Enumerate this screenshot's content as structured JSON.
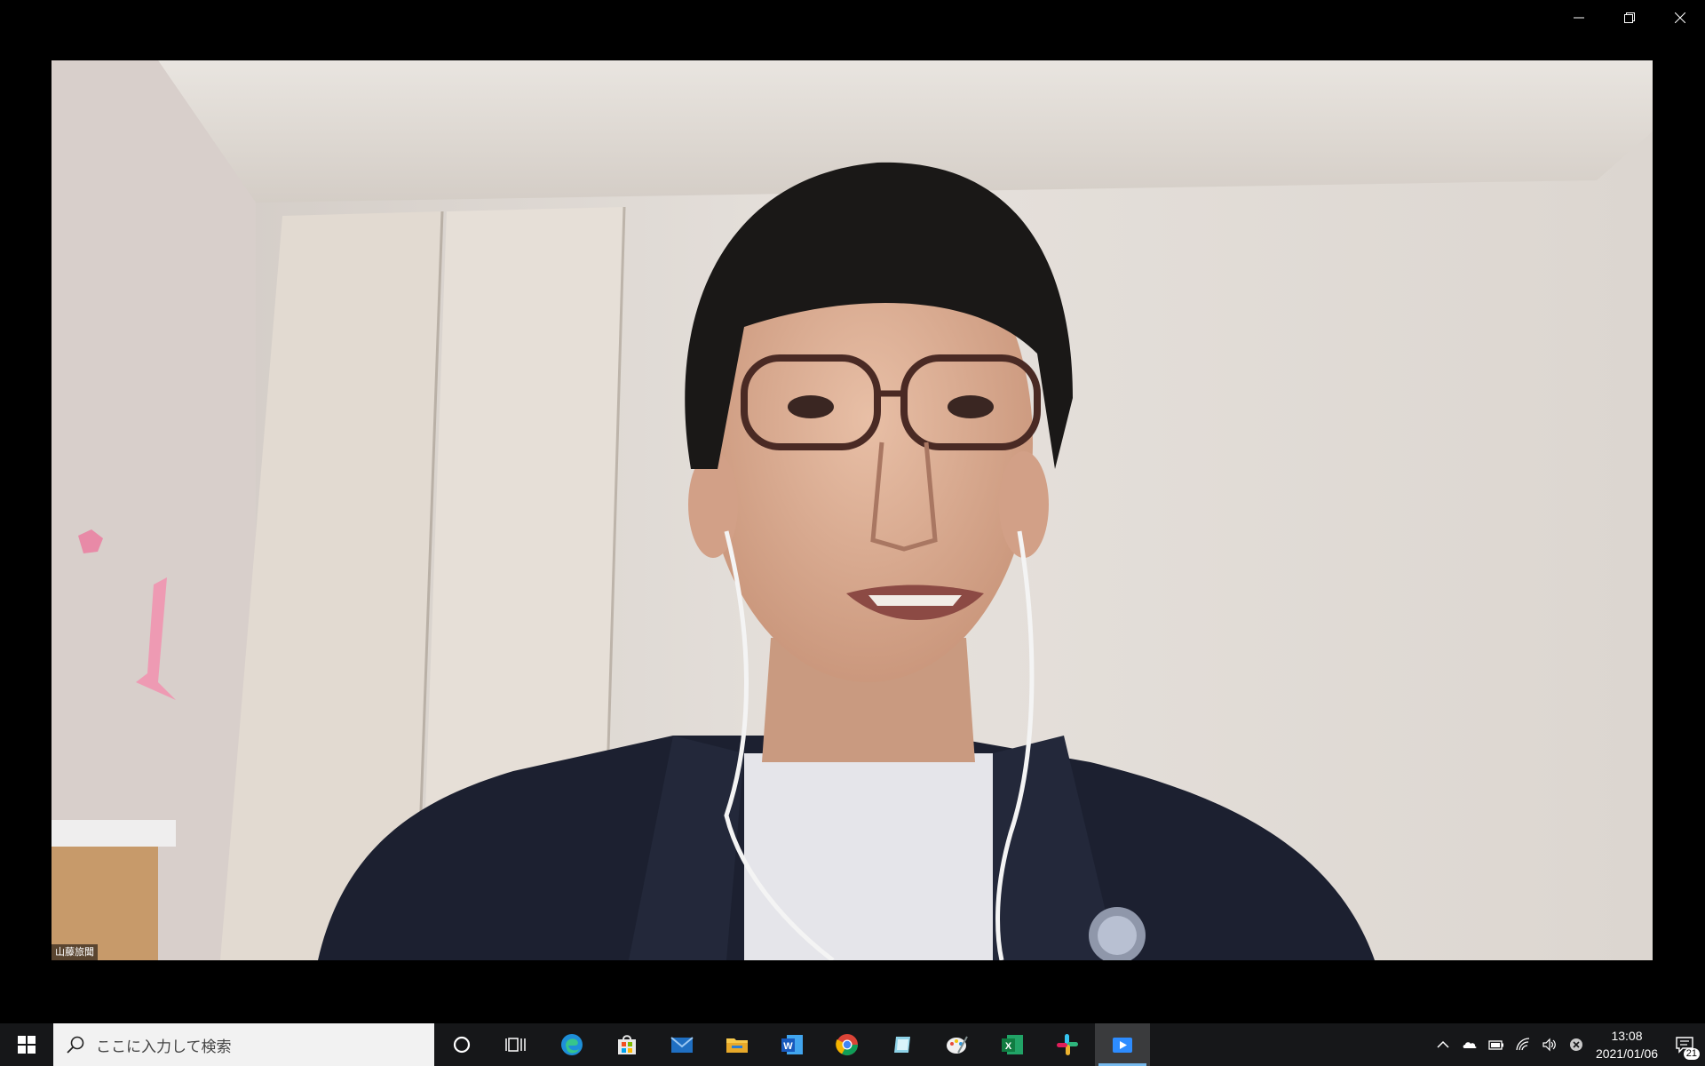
{
  "window": {
    "controls": [
      {
        "name": "minimize-button",
        "icon": "minimize-icon"
      },
      {
        "name": "restore-button",
        "icon": "restore-icon"
      },
      {
        "name": "close-button",
        "icon": "close-icon"
      }
    ]
  },
  "video": {
    "participant_name": "山藤旅聞"
  },
  "taskbar": {
    "search_placeholder": "ここに入力して検索",
    "apps": [
      {
        "name": "cortana-button",
        "icon": "circle-icon"
      },
      {
        "name": "task-view-button",
        "icon": "task-view-icon"
      },
      {
        "name": "edge-button",
        "icon": "edge-icon"
      },
      {
        "name": "store-button",
        "icon": "store-icon"
      },
      {
        "name": "mail-button",
        "icon": "mail-icon"
      },
      {
        "name": "file-explorer-button",
        "icon": "folder-icon"
      },
      {
        "name": "word-button",
        "icon": "word-icon"
      },
      {
        "name": "chrome-button",
        "icon": "chrome-icon"
      },
      {
        "name": "notes-button",
        "icon": "notes-icon"
      },
      {
        "name": "paint-button",
        "icon": "paint-icon"
      },
      {
        "name": "excel-button",
        "icon": "excel-icon"
      },
      {
        "name": "slack-button",
        "icon": "slack-icon"
      },
      {
        "name": "video-app-button",
        "icon": "video-app-icon",
        "active": true
      }
    ],
    "tray": {
      "icons": [
        "chevron-up-icon",
        "onedrive-icon",
        "battery-icon",
        "wifi-icon",
        "volume-icon",
        "ime-icon"
      ],
      "time": "13:08",
      "date": "2021/01/06",
      "notification_count": "21"
    }
  },
  "colors": {
    "taskbar_bg": "#161719",
    "accent": "#76b9ed"
  }
}
